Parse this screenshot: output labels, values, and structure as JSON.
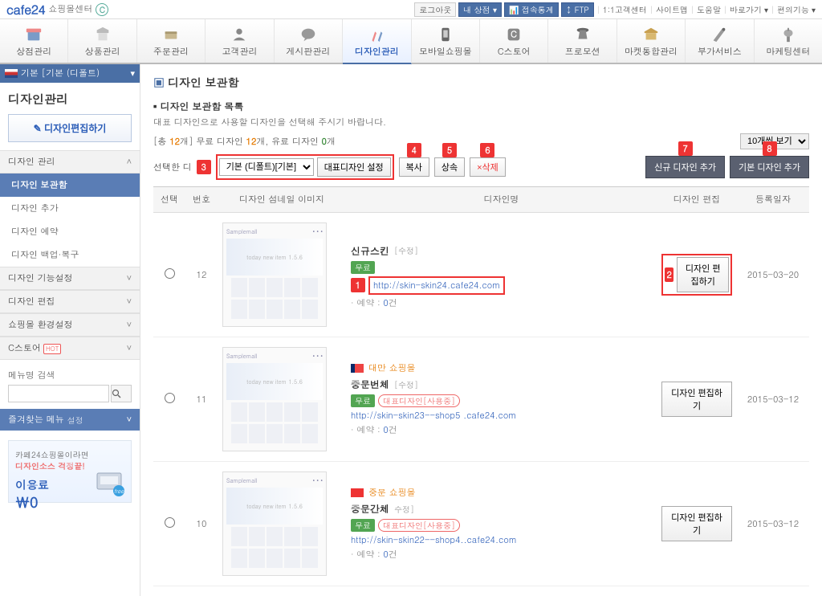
{
  "logo": {
    "brand": "cafe24",
    "sub": "쇼핑몰센터"
  },
  "topbar": {
    "logout": "로그아웃",
    "store": "내 상점",
    "stats": "접속통계",
    "ftp": "FTP",
    "links": [
      "1:1고객센터",
      "사이트맵",
      "도움말",
      "바로가기",
      "편의기능"
    ]
  },
  "nav": [
    {
      "label": "상점관리"
    },
    {
      "label": "상품관리"
    },
    {
      "label": "주문관리"
    },
    {
      "label": "고객관리"
    },
    {
      "label": "게시판관리"
    },
    {
      "label": "디자인관리"
    },
    {
      "label": "모바일쇼핑몰"
    },
    {
      "label": "C스토어"
    },
    {
      "label": "프로모션"
    },
    {
      "label": "마켓통합관리"
    },
    {
      "label": "부가서비스"
    },
    {
      "label": "마케팅센터"
    }
  ],
  "sidebar": {
    "flag_label": "기본 [기본 (디폴트)",
    "heading": "디자인관리",
    "edit_btn": "디자인편집하기",
    "sec1": {
      "title": "디자인 관리",
      "items": [
        "디자인 보관함",
        "디자인 추가",
        "디자인 예약",
        "디자인 백업·복구"
      ]
    },
    "sec2": {
      "title": "디자인 기능설정"
    },
    "sec3": {
      "title": "디자인 편집"
    },
    "sec4": {
      "title": "쇼핑몰 환경설정"
    },
    "sec5": {
      "title": "C스토어",
      "hot": "HOT"
    },
    "search_label": "메뉴명 검색",
    "fav_title": "즐겨찾는 메뉴",
    "fav_set": "설정",
    "ad": {
      "line1": "카페24쇼핑몰이라면",
      "line2": "디자인소스 걱정끝!",
      "price_label": "이용료",
      "price_val": "￦0"
    }
  },
  "page": {
    "title": "디자인 보관함",
    "sub_title": "디자인 보관함 목록",
    "sub_desc": "대표 디자인으로 사용할 디자인을 선택해 주시기 바랍니다.",
    "count_prefix": "[총 ",
    "count_total": "12",
    "count_mid": "개] 무료 디자인 ",
    "count_free": "12",
    "count_mid2": "개, 유료 디자인 ",
    "count_paid": "0",
    "count_suffix": "개",
    "page_size": "10개씩 보기"
  },
  "action": {
    "sel_label": "선택한 디",
    "default_select": "기본 (디폴트)[기본]",
    "btn_setrep": "대표디자인 설정",
    "btn_copy": "복사",
    "btn_inherit": "상속",
    "btn_delete": "×삭제",
    "btn_newdesign": "신규 디자인 추가",
    "btn_basedesign": "기본 디자인 추가"
  },
  "badges": {
    "b1": "1",
    "b2": "2",
    "b3": "3",
    "b4": "4",
    "b5": "5",
    "b6": "6",
    "b7": "7",
    "b8": "8"
  },
  "table": {
    "th": [
      "선택",
      "번호",
      "디자인 섬네일 이미지",
      "디자인명",
      "디자인 편집",
      "등록일자"
    ],
    "edit_btn": "디자인 편집하기",
    "free_badge": "무료",
    "rep_badge": "대표디자인[사용중]",
    "reserve_prefix": "· 예약 : ",
    "reserve_zero": "0",
    "reserve_suffix": "건",
    "rows": [
      {
        "num": "12",
        "name": "신규스킨",
        "sub": "[수정]",
        "country": "",
        "url": "http://skin-skin24.cafe24.com",
        "date": "2015-03-20",
        "rep": false,
        "highlight": true
      },
      {
        "num": "11",
        "name": "중문번체",
        "sub": "[수정]",
        "country": "대만 쇼핑몰",
        "flag": "tw",
        "url": "http://skin-skin23--shop5 .cafe24.com",
        "date": "2015-03-12",
        "rep": true,
        "highlight": false
      },
      {
        "num": "10",
        "name": "중문간체",
        "sub": "수정]",
        "country": "중문 쇼핑몰",
        "flag": "cn",
        "url": "http://skin-skin22--shop4..cafe24.com",
        "date": "2015-03-12",
        "rep": true,
        "highlight": false
      }
    ]
  }
}
